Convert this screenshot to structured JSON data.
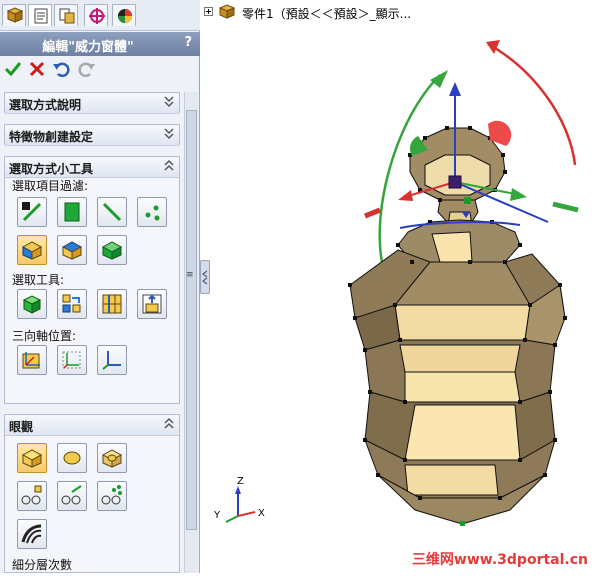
{
  "property_manager": {
    "title": "編輯\"威力窗體\"",
    "help": "?",
    "tabs": [
      "feature-manager-icon",
      "property-manager-icon",
      "configuration-manager-icon",
      "dimxpert-icon",
      "display-manager-icon"
    ],
    "groups": {
      "selection_help": {
        "title": "選取方式說明"
      },
      "feature_settings": {
        "title": "特徵物創建設定"
      },
      "selection_tools": {
        "title": "選取方式小工具",
        "filter_label": "選取項目過濾:",
        "tools_label": "選取工具:",
        "triad_label": "三向軸位置:"
      },
      "display": {
        "title": "眼觀",
        "subdivision_label": "細分層次數"
      }
    }
  },
  "tree": {
    "part_label": "零件1（預設＜＜預設＞_顯示..."
  },
  "triad_axes": {
    "x": "X",
    "y": "Y",
    "z": "Z"
  },
  "watermark": "三维网www.3dportal.cn",
  "colors": {
    "accent": "#6d7fa3",
    "model_face": "#9d8a66",
    "model_light": "#fae3ac",
    "watermark": "#e63a3a"
  }
}
